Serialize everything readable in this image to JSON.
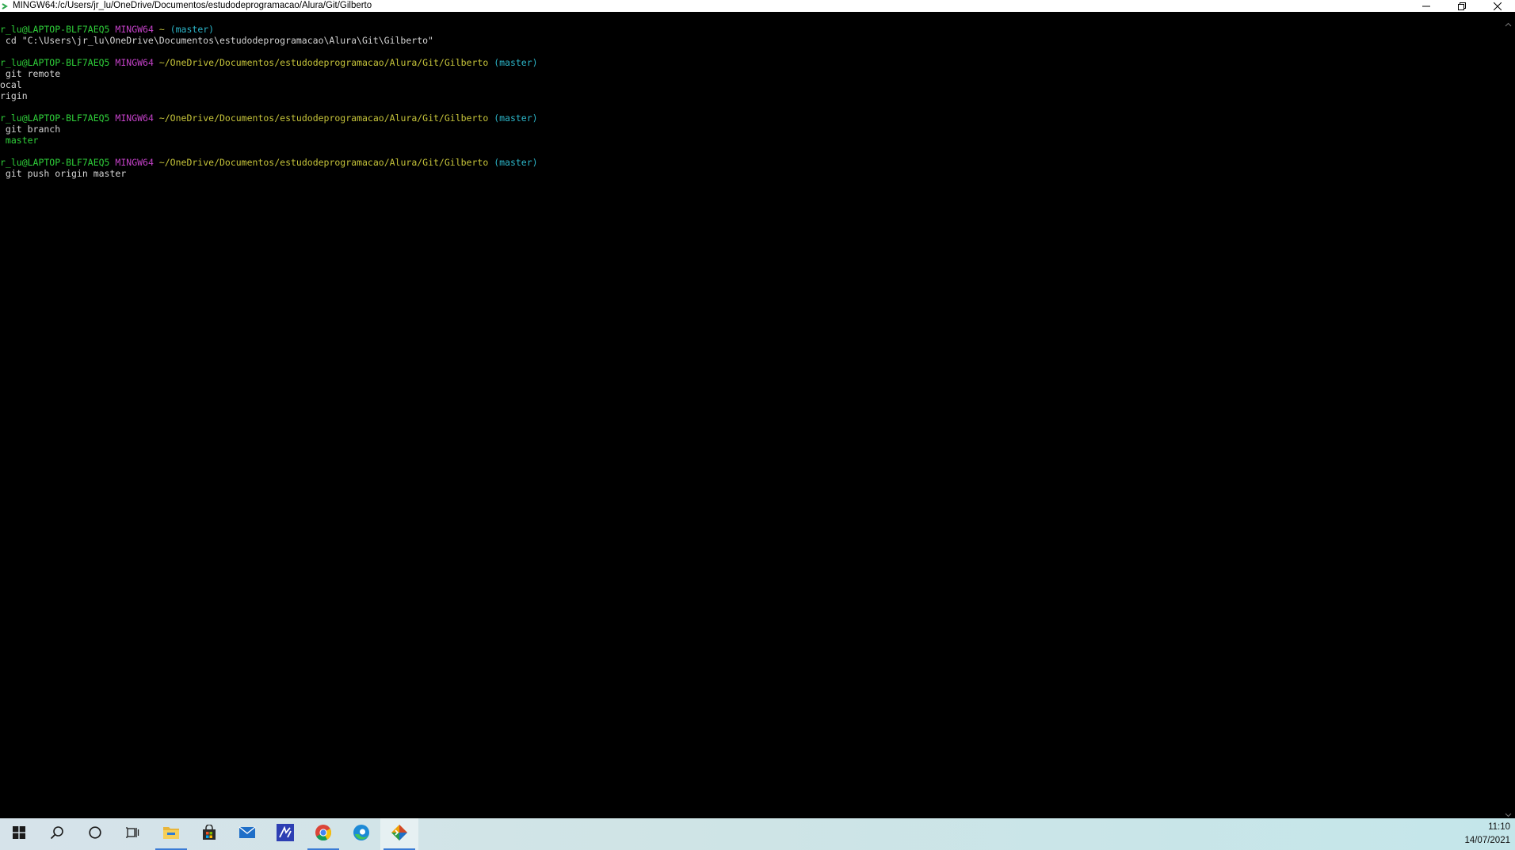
{
  "window": {
    "title": "MINGW64:/c/Users/jr_lu/OneDrive/Documentos/estudodeprogramacao/Alura/Git/Gilberto"
  },
  "terminal": {
    "blocks": [
      {
        "prompt": {
          "user": "r_lu@LAPTOP-BLF7AEQ5",
          "env": "MINGW64",
          "path": "~",
          "branch": "(master)"
        },
        "command": " cd \"C:\\Users\\jr_lu\\OneDrive\\Documentos\\estudodeprogramacao\\Alura\\Git\\Gilberto\"",
        "output": []
      },
      {
        "prompt": {
          "user": "r_lu@LAPTOP-BLF7AEQ5",
          "env": "MINGW64",
          "path": "~/OneDrive/Documentos/estudodeprogramacao/Alura/Git/Gilberto",
          "branch": "(master)"
        },
        "command": " git remote",
        "output": [
          "ocal",
          "rigin"
        ]
      },
      {
        "prompt": {
          "user": "r_lu@LAPTOP-BLF7AEQ5",
          "env": "MINGW64",
          "path": "~/OneDrive/Documentos/estudodeprogramacao/Alura/Git/Gilberto",
          "branch": "(master)"
        },
        "command": " git branch",
        "output_highlight": " master"
      },
      {
        "prompt": {
          "user": "r_lu@LAPTOP-BLF7AEQ5",
          "env": "MINGW64",
          "path": "~/OneDrive/Documentos/estudodeprogramacao/Alura/Git/Gilberto",
          "branch": "(master)"
        },
        "command": " git push origin master",
        "output": []
      }
    ]
  },
  "taskbar": {
    "items": [
      {
        "icon": "windows-start-icon"
      },
      {
        "icon": "search-icon"
      },
      {
        "icon": "cortana-icon"
      },
      {
        "icon": "task-view-icon"
      },
      {
        "icon": "file-explorer-icon"
      },
      {
        "icon": "store-icon"
      },
      {
        "icon": "mail-icon"
      },
      {
        "icon": "editor-app-icon"
      },
      {
        "icon": "chrome-icon"
      },
      {
        "icon": "edge-icon"
      },
      {
        "icon": "git-bash-icon"
      }
    ],
    "clock": {
      "time": "11:10",
      "date": "14/07/2021"
    }
  },
  "colors": {
    "prompt_user": "#2fd03a",
    "prompt_env": "#c441c8",
    "prompt_path": "#c6c43a",
    "prompt_branch": "#2cb6c9",
    "taskbar_accent": "#3a7bd5"
  }
}
